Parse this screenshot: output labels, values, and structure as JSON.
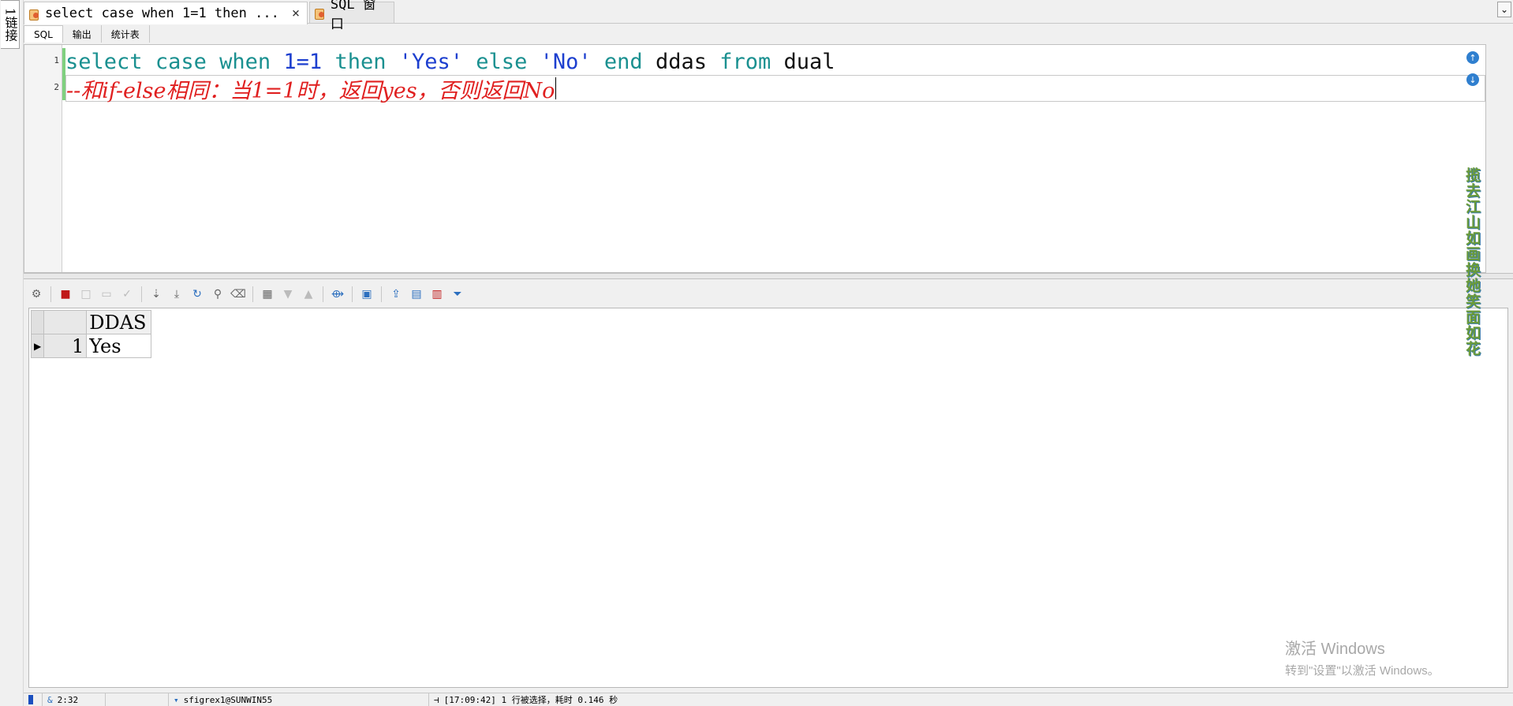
{
  "connections": {
    "label": "1链接"
  },
  "doc_tabs": [
    {
      "label": "select case when 1=1 then  ...",
      "close": "×",
      "active": true
    },
    {
      "label": "SQL 窗口",
      "active": false
    }
  ],
  "scroll_down_icon": "chevron-down-icon",
  "sub_tabs": [
    "SQL",
    "输出",
    "统计表"
  ],
  "editor": {
    "line_numbers": [
      "1",
      "2"
    ],
    "line1": {
      "select": "select",
      "case": "case",
      "when": "when",
      "cond": "1=1",
      "then": "then",
      "yes": "'Yes'",
      "else": "else",
      "no": "'No'",
      "end": "end",
      "alias": "ddas",
      "from": "from",
      "table": "dual"
    },
    "line2": "--和if-else相同：当1=1时，返回yes，否则返回No",
    "nav_up": "↑",
    "nav_down": "↓"
  },
  "results": {
    "columns": [
      "DDAS"
    ],
    "rows": [
      {
        "no": "1",
        "values": [
          "Yes"
        ]
      }
    ]
  },
  "side_poem": "揽去江山如画换她笑面如花",
  "watermark": {
    "line1": "激活 Windows",
    "line2": "转到\"设置\"以激活 Windows。"
  },
  "status": {
    "position": "2:32",
    "connection": "sfigrex1@SUNWIN55",
    "message": "[17:09:42] 1 行被选择，耗时 0.146 秒"
  },
  "colors": {
    "keyword": "#1a9090",
    "string": "#1d3fcf",
    "comment": "#e02020"
  }
}
